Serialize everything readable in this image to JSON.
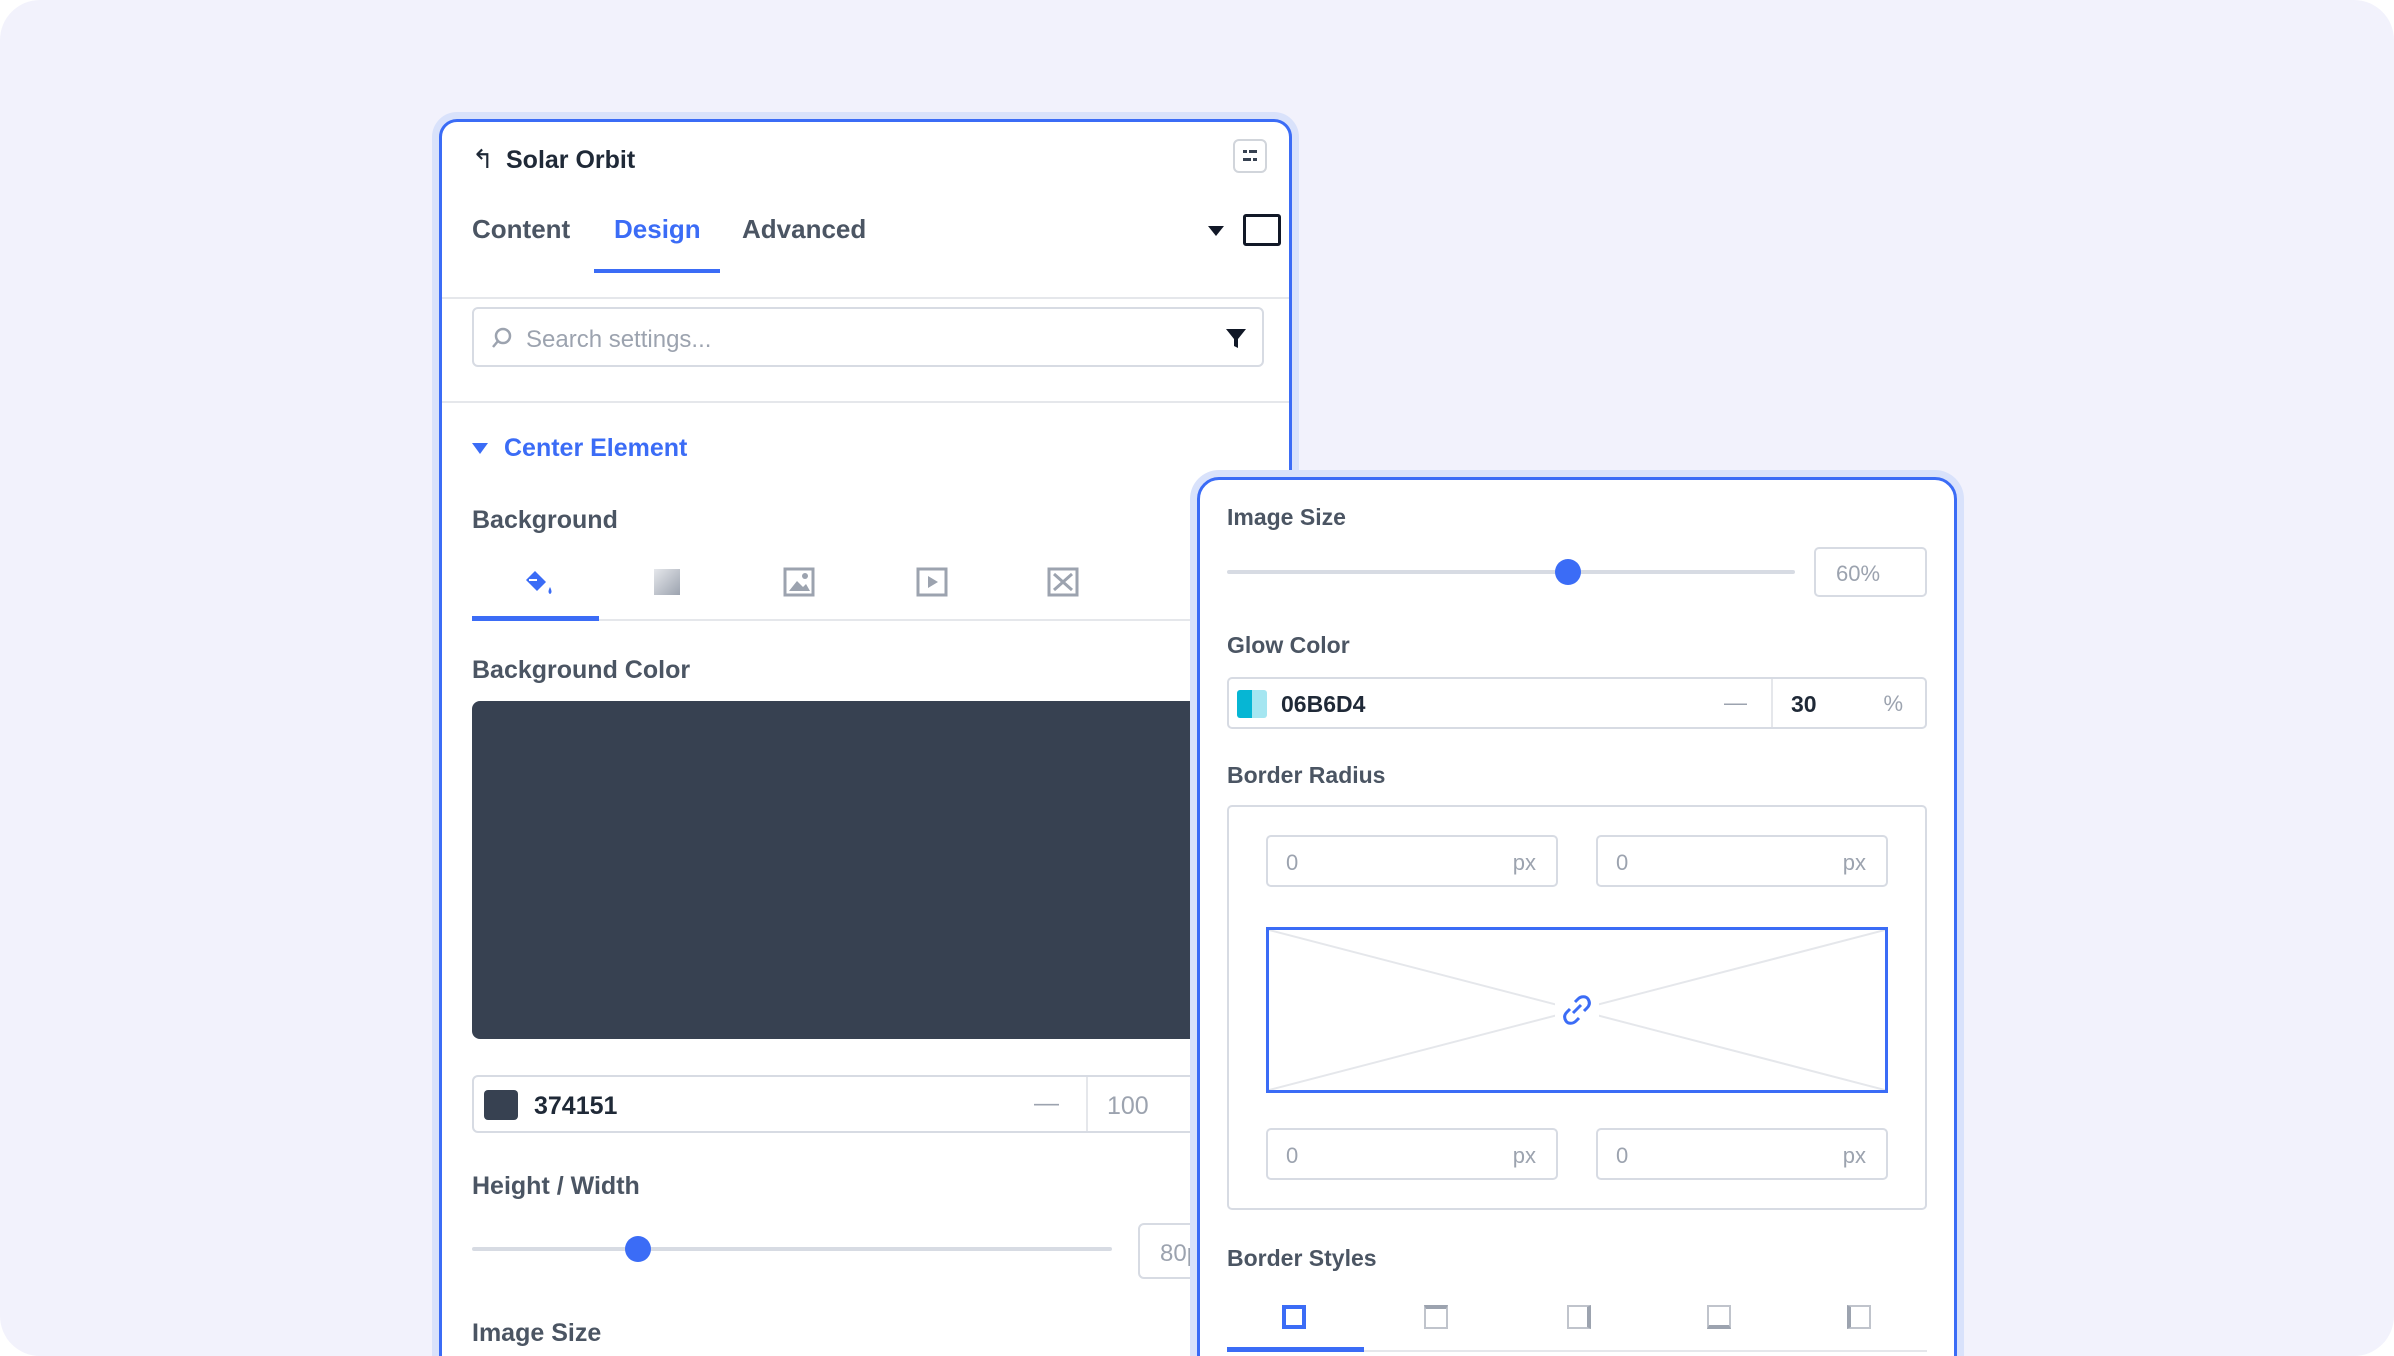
{
  "header": {
    "back_icon": "back-arrow-icon",
    "title": "Solar Orbit",
    "menu_icon": "panel-menu-icon"
  },
  "tabs": [
    {
      "label": "Content",
      "active": false
    },
    {
      "label": "Design",
      "active": true
    },
    {
      "label": "Advanced",
      "active": false
    }
  ],
  "search": {
    "placeholder": "Search settings...",
    "icon": "search-icon",
    "filter_icon": "filter-icon"
  },
  "section": {
    "title": "Center Element",
    "expanded": true
  },
  "background": {
    "label": "Background",
    "types": [
      {
        "name": "classic",
        "icon": "paint-bucket-icon",
        "active": true
      },
      {
        "name": "gradient",
        "icon": "gradient-icon",
        "active": false
      },
      {
        "name": "image",
        "icon": "image-icon",
        "active": false
      },
      {
        "name": "video",
        "icon": "video-icon",
        "active": false
      },
      {
        "name": "slideshow",
        "icon": "slideshow-icon",
        "active": false
      }
    ]
  },
  "background_color": {
    "label": "Background Color",
    "hex": "374151",
    "swatch": "#374151",
    "dash": "—",
    "opacity": "100"
  },
  "height_width": {
    "label": "Height / Width",
    "value_fraction": 0.26,
    "value_text": "80p"
  },
  "image_size_left": {
    "label": "Image Size"
  },
  "right": {
    "image_size": {
      "label": "Image Size",
      "value": "60%",
      "value_fraction": 0.6
    },
    "glow_color": {
      "label": "Glow Color",
      "hex": "06B6D4",
      "swatch": "#06B6D4",
      "dash": "—",
      "opacity": "30",
      "unit": "%"
    },
    "border_radius": {
      "label": "Border Radius",
      "top_left": "0",
      "top_right": "0",
      "bottom_left": "0",
      "bottom_right": "0",
      "unit": "px",
      "link_icon": "link-icon"
    },
    "border_styles": {
      "label": "Border Styles",
      "options": [
        "all-sides",
        "top",
        "right",
        "bottom",
        "left"
      ],
      "active": "all-sides"
    }
  },
  "colors": {
    "accent": "#3B6CF6",
    "panel_glow": "#D9E2FB",
    "canvas": "#F2F2FC"
  }
}
